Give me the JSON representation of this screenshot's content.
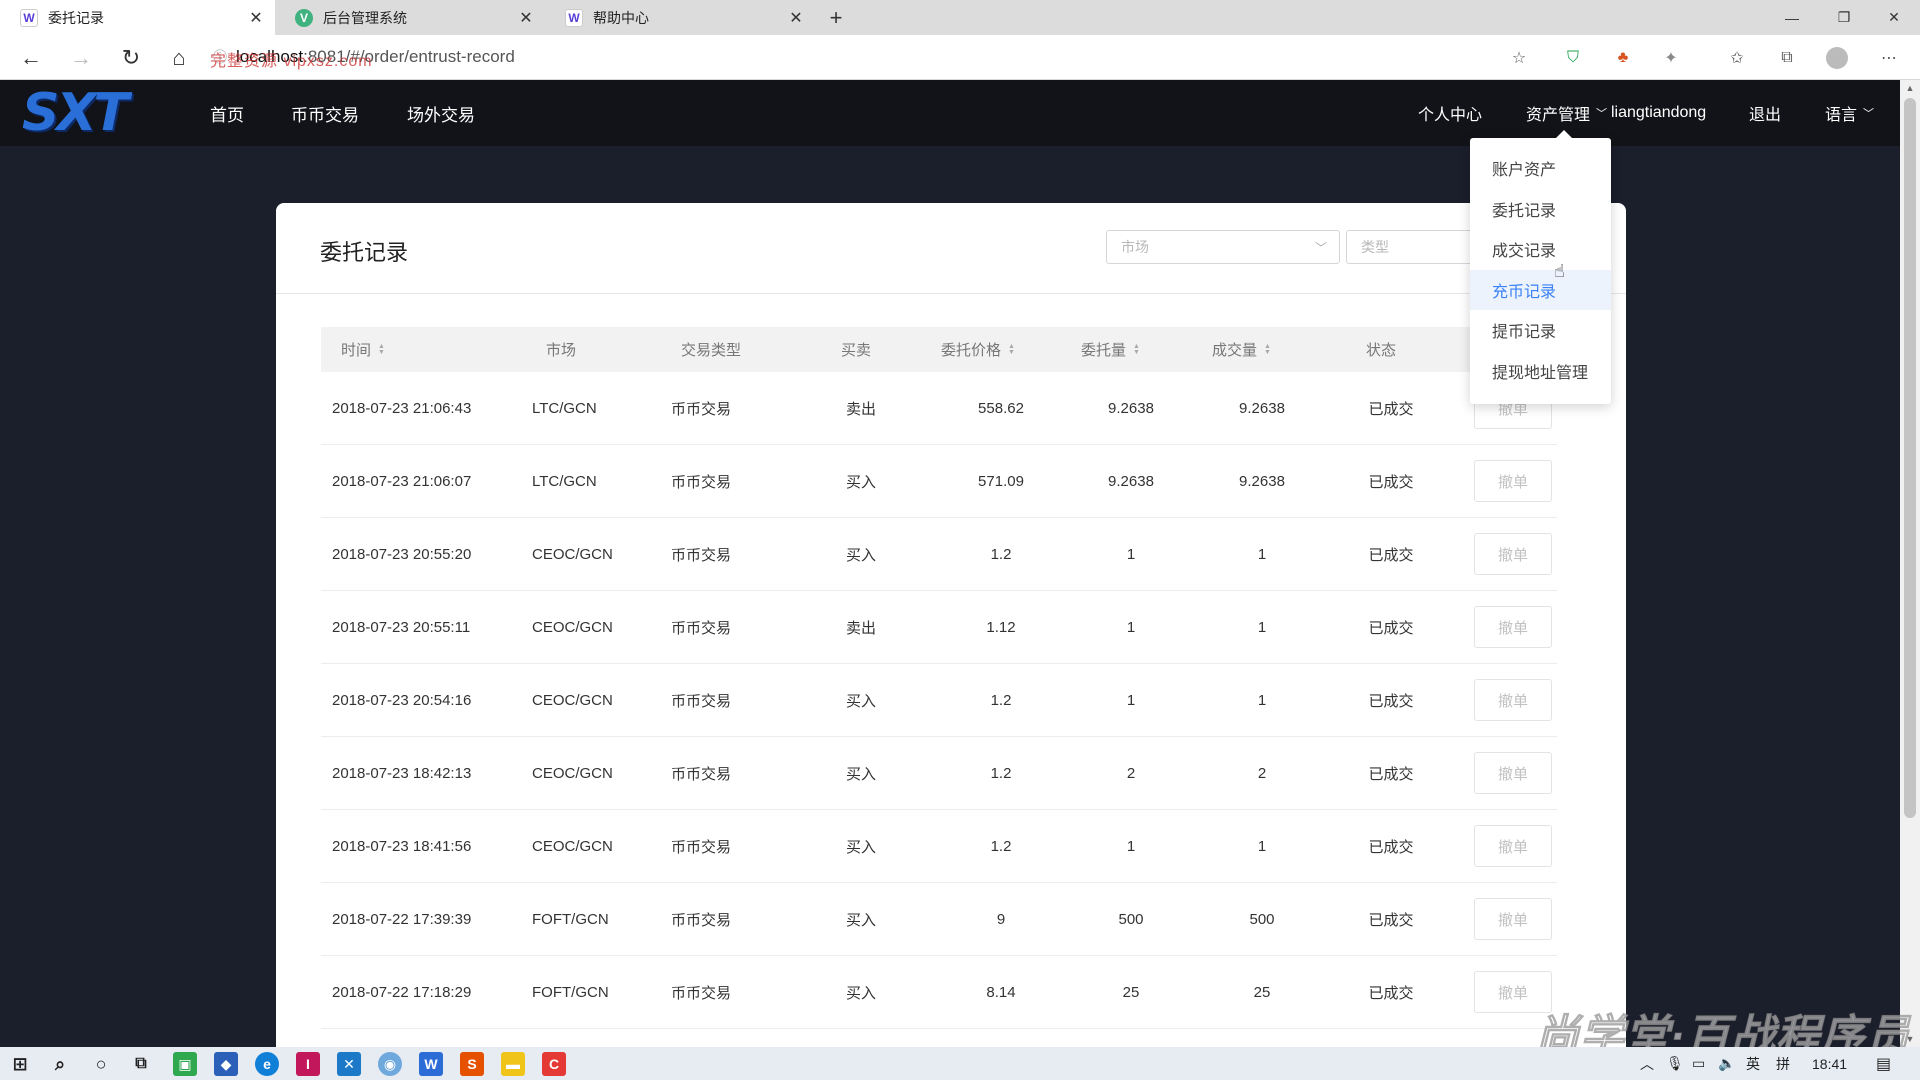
{
  "browser": {
    "tabs": [
      {
        "title": "委托记录",
        "favicon": "W",
        "active": true
      },
      {
        "title": "后台管理系统",
        "favicon": "V",
        "active": false
      },
      {
        "title": "帮助中心",
        "favicon": "W",
        "active": false
      }
    ],
    "tab_close_glyph": "✕",
    "new_tab_glyph": "+",
    "url_watermark": "完整资源 vipxsz.com",
    "url_host": "localhost",
    "url_path": ":8081/#/order/entrust-record",
    "window_controls": {
      "minimize": "—",
      "restore": "❐",
      "close": "✕"
    }
  },
  "site": {
    "logo_text": "SXT",
    "brand_color": "#2a6fd8",
    "nav": [
      "首页",
      "币币交易",
      "场外交易"
    ],
    "right_nav": {
      "personal_center": "个人中心",
      "asset_management": "资产管理",
      "username": "liangtiandong",
      "logout": "退出",
      "language": "语言"
    }
  },
  "dropdown": {
    "items": [
      "账户资产",
      "委托记录",
      "成交记录",
      "充币记录",
      "提币记录",
      "提现地址管理"
    ],
    "highlighted_index": 3,
    "highlight_color": "#3b82f6"
  },
  "page": {
    "title": "委托记录",
    "filters": {
      "market_placeholder": "市场",
      "type_placeholder": "类型"
    },
    "columns": [
      "时间",
      "市场",
      "交易类型",
      "买卖",
      "委托价格",
      "委托量",
      "成交量",
      "状态",
      ""
    ],
    "sortable_columns": [
      "时间",
      "委托价格",
      "委托量",
      "成交量"
    ],
    "cancel_label": "撤单",
    "rows": [
      {
        "time": "2018-07-23 21:06:43",
        "market": "LTC/GCN",
        "type": "币币交易",
        "side": "卖出",
        "price": "558.62",
        "amount": "9.2638",
        "filled": "9.2638",
        "status": "已成交"
      },
      {
        "time": "2018-07-23 21:06:07",
        "market": "LTC/GCN",
        "type": "币币交易",
        "side": "买入",
        "price": "571.09",
        "amount": "9.2638",
        "filled": "9.2638",
        "status": "已成交"
      },
      {
        "time": "2018-07-23 20:55:20",
        "market": "CEOC/GCN",
        "type": "币币交易",
        "side": "买入",
        "price": "1.2",
        "amount": "1",
        "filled": "1",
        "status": "已成交"
      },
      {
        "time": "2018-07-23 20:55:11",
        "market": "CEOC/GCN",
        "type": "币币交易",
        "side": "卖出",
        "price": "1.12",
        "amount": "1",
        "filled": "1",
        "status": "已成交"
      },
      {
        "time": "2018-07-23 20:54:16",
        "market": "CEOC/GCN",
        "type": "币币交易",
        "side": "买入",
        "price": "1.2",
        "amount": "1",
        "filled": "1",
        "status": "已成交"
      },
      {
        "time": "2018-07-23 18:42:13",
        "market": "CEOC/GCN",
        "type": "币币交易",
        "side": "买入",
        "price": "1.2",
        "amount": "2",
        "filled": "2",
        "status": "已成交"
      },
      {
        "time": "2018-07-23 18:41:56",
        "market": "CEOC/GCN",
        "type": "币币交易",
        "side": "买入",
        "price": "1.2",
        "amount": "1",
        "filled": "1",
        "status": "已成交"
      },
      {
        "time": "2018-07-22 17:39:39",
        "market": "FOFT/GCN",
        "type": "币币交易",
        "side": "买入",
        "price": "9",
        "amount": "500",
        "filled": "500",
        "status": "已成交"
      },
      {
        "time": "2018-07-22 17:18:29",
        "market": "FOFT/GCN",
        "type": "币币交易",
        "side": "买入",
        "price": "8.14",
        "amount": "25",
        "filled": "25",
        "status": "已成交"
      }
    ]
  },
  "watermark": "尚学堂·百战程序员",
  "taskbar": {
    "ime_lang": "英",
    "ime_mode": "拼",
    "clock": "18:41"
  }
}
